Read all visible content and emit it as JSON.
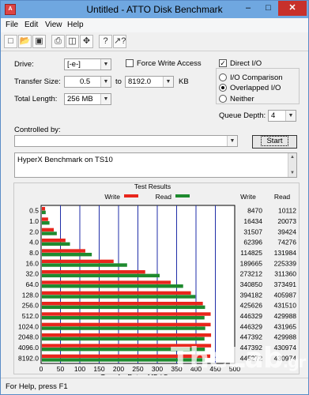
{
  "window": {
    "title": "Untitled - ATTO Disk Benchmark",
    "app_icon": "atto-icon"
  },
  "menu": {
    "file": "File",
    "edit": "Edit",
    "view": "View",
    "help": "Help"
  },
  "toolbar": {
    "new": "new-file",
    "open": "open-folder",
    "save": "save",
    "print": "print",
    "print_preview": "print-preview",
    "move": "move",
    "help": "help",
    "context_help": "context-help"
  },
  "settings": {
    "drive_label": "Drive:",
    "drive_value": "[-e-]",
    "transfer_size_label": "Transfer Size:",
    "transfer_from": "0.5",
    "to_label": "to",
    "transfer_to": "8192.0",
    "unit": "KB",
    "total_length_label": "Total Length:",
    "total_length_value": "256 MB",
    "force_write_access_label": "Force Write Access",
    "direct_io_label": "Direct I/O",
    "io_comparison_label": "I/O Comparison",
    "overlapped_io_label": "Overlapped I/O",
    "neither_label": "Neither",
    "queue_depth_label": "Queue Depth:",
    "queue_depth_value": "4",
    "controlled_by_label": "Controlled by:",
    "controlled_by_value": "",
    "start_label": "Start",
    "description": "HyperX Benchmark on TS10"
  },
  "results": {
    "group_title": "Test Results",
    "write_legend": "Write",
    "read_legend": "Read",
    "write_col": "Write",
    "read_col": "Read",
    "write_color": "#e8261c",
    "read_color": "#1e8a2e"
  },
  "chart_data": {
    "type": "bar",
    "orientation": "horizontal",
    "title": "Test Results",
    "xlabel": "Transfer Rate - MB / Sec",
    "xlim": [
      0,
      500
    ],
    "xticks": [
      "0",
      "50",
      "100",
      "150",
      "200",
      "250",
      "300",
      "350",
      "400",
      "450",
      "500"
    ],
    "grid": true,
    "legend": "top",
    "categories": [
      "0.5",
      "1.0",
      "2.0",
      "4.0",
      "8.0",
      "16.0",
      "32.0",
      "64.0",
      "128.0",
      "256.0",
      "512.0",
      "1024.0",
      "2048.0",
      "4096.0",
      "8192.0"
    ],
    "series": [
      {
        "name": "Write",
        "values": [
          8470,
          16434,
          31507,
          62396,
          114825,
          189665,
          273212,
          340850,
          394182,
          425626,
          446329,
          446329,
          447392,
          447392,
          445272
        ]
      },
      {
        "name": "Read",
        "values": [
          10112,
          20073,
          39424,
          74276,
          131984,
          225339,
          311360,
          373491,
          405987,
          431510,
          429988,
          431965,
          429988,
          430974,
          430974
        ]
      }
    ],
    "value_scale": "KB/s"
  },
  "status": {
    "text": "For Help, press F1"
  },
  "watermark": {
    "main": "TheLab",
    "suffix": ".gr"
  }
}
